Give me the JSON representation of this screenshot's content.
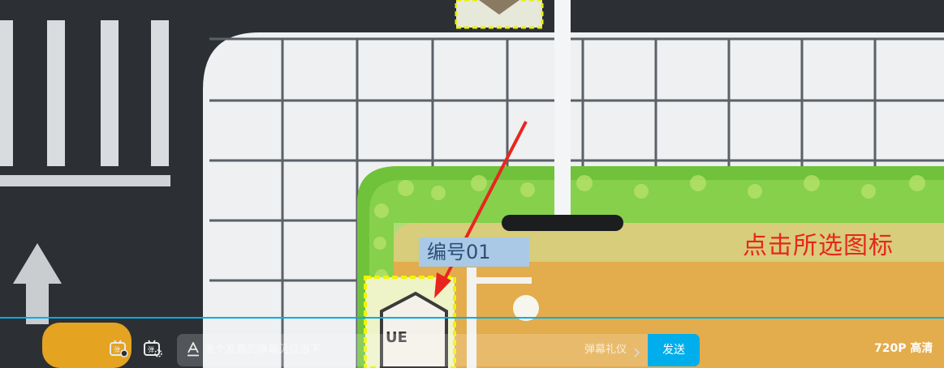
{
  "video": {
    "caption_text": "点击所选图标",
    "plate_text": "编号01",
    "badge_text": "UE"
  },
  "player": {
    "progress_percent": 100,
    "danmaku_toggle_icon": "danmaku-toggle-icon",
    "danmaku_settings_icon": "danmaku-settings-icon",
    "input_placeholder": "发个友善的弹幕见证当下",
    "etiquette_label": "弹幕礼仪",
    "send_label": "发送",
    "quality_label": "720P 高清"
  },
  "colors": {
    "accent": "#00aeec",
    "caption": "#e8261e"
  }
}
